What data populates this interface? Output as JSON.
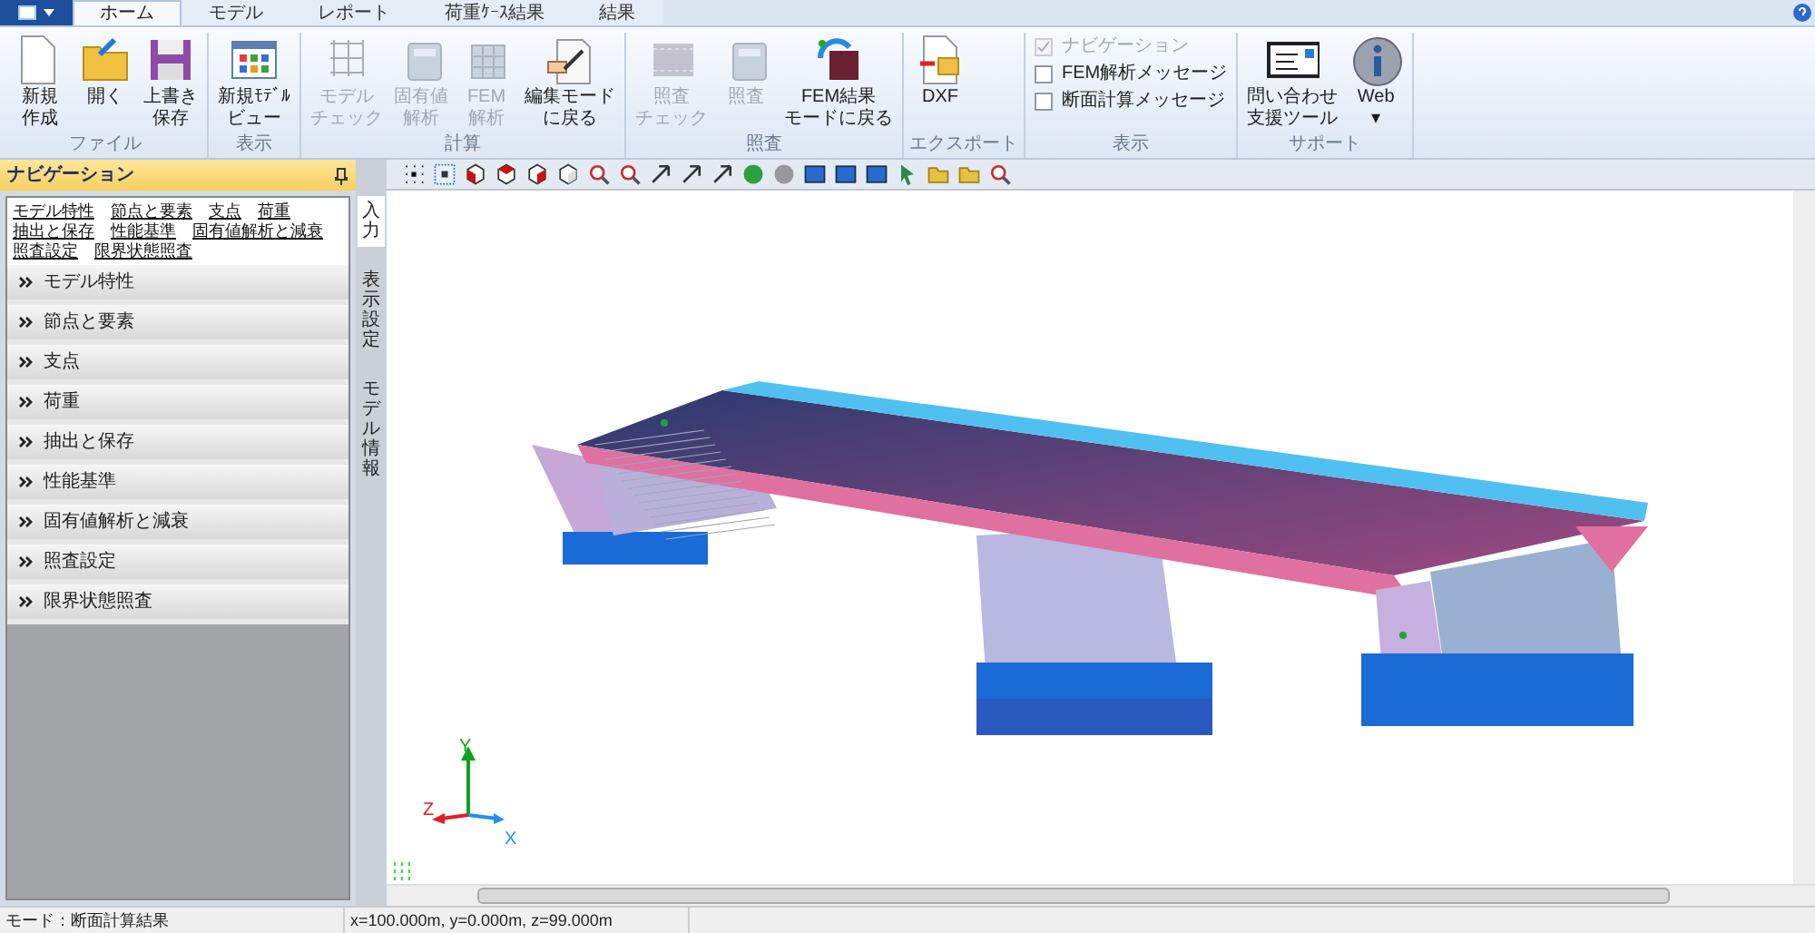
{
  "ribbon_tabs": [
    {
      "label": "ホーム",
      "selected": true
    },
    {
      "label": "モデル",
      "selected": false
    },
    {
      "label": "レポート",
      "selected": false
    },
    {
      "label": "荷重ｹｰｽ結果",
      "selected": false
    },
    {
      "label": "結果",
      "selected": false
    }
  ],
  "ribbon_groups": [
    {
      "title": "ファイル",
      "buttons": [
        {
          "lines": [
            "新規",
            "作成"
          ],
          "disabled": false
        },
        {
          "lines": [
            "開く"
          ],
          "disabled": false
        },
        {
          "lines": [
            "上書き",
            "保存"
          ],
          "disabled": false
        }
      ]
    },
    {
      "title": "表示",
      "buttons": [
        {
          "lines": [
            "新規ﾓﾃﾞﾙ",
            "ビュー"
          ],
          "disabled": false
        }
      ]
    },
    {
      "title": "計算",
      "buttons": [
        {
          "lines": [
            "モデル",
            "チェック"
          ],
          "disabled": true
        },
        {
          "lines": [
            "固有値",
            "解析"
          ],
          "disabled": true
        },
        {
          "lines": [
            "FEM",
            "解析"
          ],
          "disabled": true
        },
        {
          "lines": [
            "編集モード",
            "に戻る"
          ],
          "disabled": false
        }
      ]
    },
    {
      "title": "照査",
      "buttons": [
        {
          "lines": [
            "照査",
            "チェック"
          ],
          "disabled": true
        },
        {
          "lines": [
            "照査"
          ],
          "disabled": true
        },
        {
          "lines": [
            "FEM結果",
            "モードに戻る"
          ],
          "disabled": false
        }
      ]
    },
    {
      "title": "エクスポート",
      "buttons": [
        {
          "lines": [
            "DXF"
          ],
          "disabled": false
        }
      ]
    },
    {
      "title": "表示",
      "checkboxes": [
        {
          "label": "ナビゲーション",
          "checked": true,
          "disabled": true
        },
        {
          "label": "FEM解析メッセージ",
          "checked": false,
          "disabled": false
        },
        {
          "label": "断面計算メッセージ",
          "checked": false,
          "disabled": false
        }
      ]
    },
    {
      "title": "サポート",
      "buttons": [
        {
          "lines": [
            "問い合わせ",
            "支援ツール"
          ],
          "disabled": false
        },
        {
          "lines": [
            "Web",
            "▾"
          ],
          "disabled": false
        }
      ]
    }
  ],
  "navigation": {
    "title": "ナビゲーション",
    "links": [
      [
        "モデル特性",
        "節点と要素",
        "支点",
        "荷重"
      ],
      [
        "抽出と保存",
        "性能基準",
        "固有値解析と減衰"
      ],
      [
        "照査設定",
        "限界状態照査"
      ]
    ],
    "sections": [
      {
        "label": "モデル特性",
        "expanded": false
      },
      {
        "label": "節点と要素",
        "expanded": false
      },
      {
        "label": "支点",
        "expanded": false
      },
      {
        "label": "荷重",
        "expanded": false
      },
      {
        "label": "抽出と保存",
        "expanded": false
      },
      {
        "label": "性能基準",
        "expanded": false
      },
      {
        "label": "固有値解析と減衰",
        "expanded": false
      },
      {
        "label": "照査設定",
        "expanded": false
      },
      {
        "label": "限界状態照査",
        "expanded": false
      }
    ],
    "side_tabs": [
      {
        "label": "入力",
        "selected": true
      },
      {
        "label": "表示設定",
        "selected": false
      },
      {
        "label": "モデル情報",
        "selected": false
      }
    ]
  },
  "viewport": {
    "axes": {
      "x": "X",
      "y": "Y",
      "z": "Z"
    }
  },
  "status_bar": {
    "mode": "モード：断面計算結果",
    "coordinates": "x=100.000m, y=0.000m, z=99.000m"
  }
}
